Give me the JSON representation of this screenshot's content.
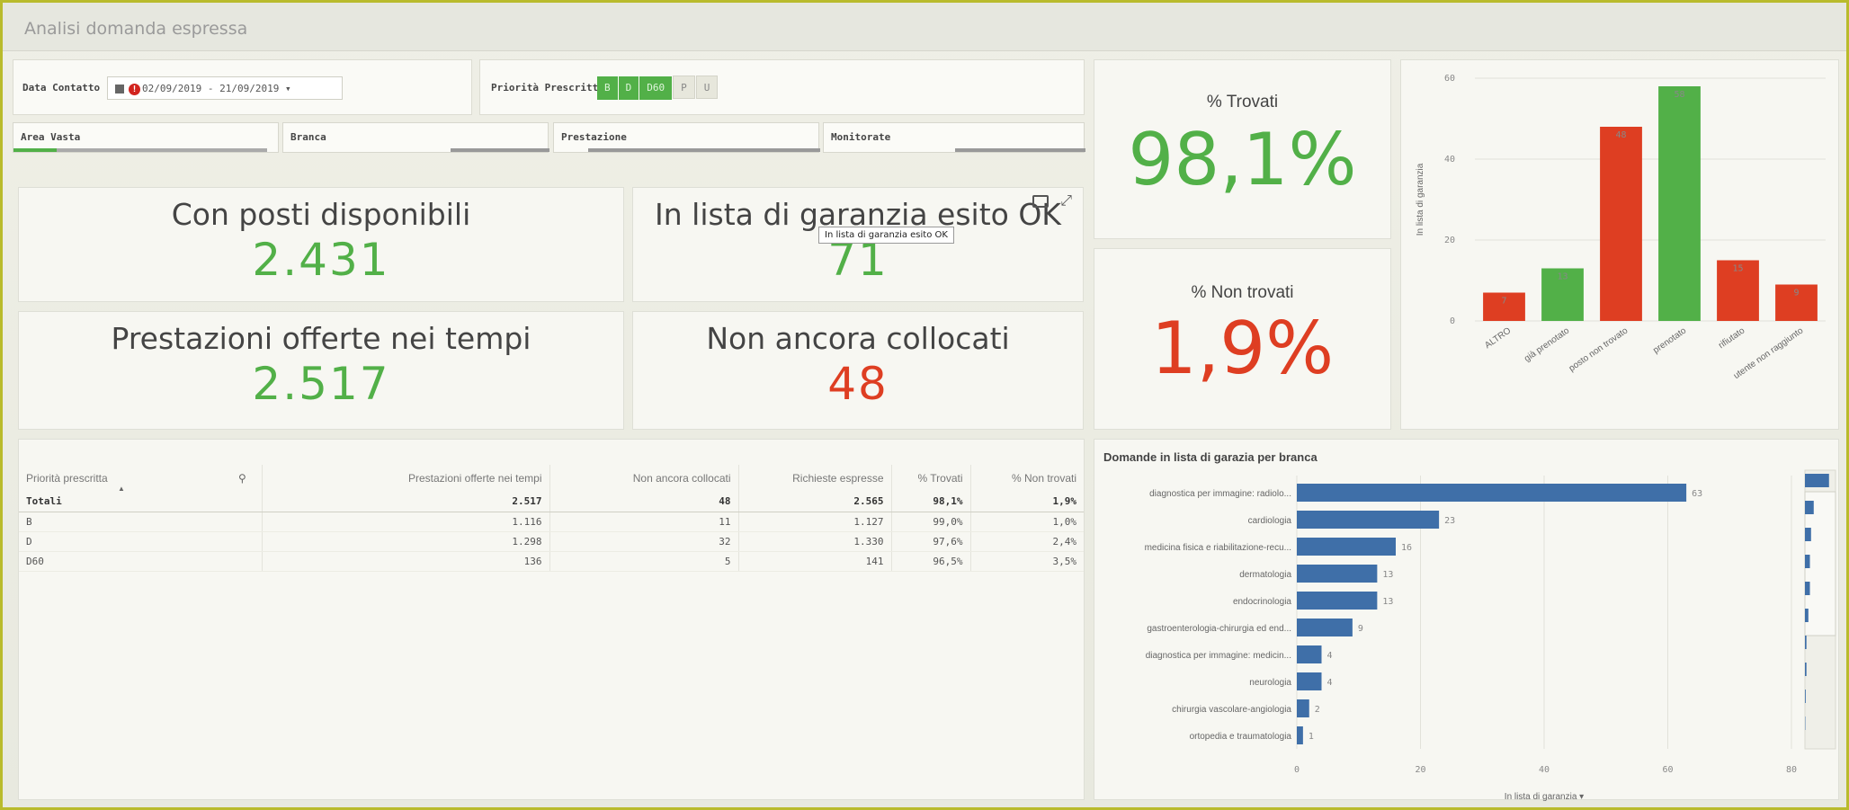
{
  "app_title": "Analisi domanda espressa",
  "filters": {
    "data_contatto_label": "Data Contatto",
    "data_contatto_value": "02/09/2019 - 21/09/2019 ▾",
    "priorita_label": "Priorità Prescritta",
    "priorita_chips": [
      {
        "label": "B",
        "selected": true
      },
      {
        "label": "D",
        "selected": true
      },
      {
        "label": "D60",
        "selected": true
      },
      {
        "label": "P",
        "selected": false
      },
      {
        "label": "U",
        "selected": false
      }
    ],
    "dimensions": [
      "Area Vasta",
      "Branca",
      "Prestazione",
      "Monitorate"
    ]
  },
  "kpis": {
    "con_posti": {
      "title": "Con posti disponibili",
      "value": "2.431"
    },
    "garanzia_ok": {
      "title": "In lista di garanzia esito OK",
      "value": "71",
      "tooltip": "In lista di garanzia esito OK"
    },
    "prestazioni_offerte": {
      "title": "Prestazioni offerte nei tempi",
      "value": "2.517"
    },
    "non_collocati": {
      "title": "Non ancora collocati",
      "value": "48"
    },
    "trovati": {
      "title": "% Trovati",
      "value": "98,1%"
    },
    "non_trovati": {
      "title": "% Non trovati",
      "value": "1,9%"
    }
  },
  "colors": {
    "green": "#52b048",
    "red": "#de3e22",
    "blue": "#3f6fa8"
  },
  "table": {
    "columns": [
      "Priorità prescritta",
      "Prestazioni offerte nei tempi",
      "Non ancora collocati",
      "Richieste espresse",
      "% Trovati",
      "% Non trovati"
    ],
    "total": [
      "Totali",
      "2.517",
      "48",
      "2.565",
      "98,1%",
      "1,9%"
    ],
    "rows": [
      [
        "B",
        "1.116",
        "11",
        "1.127",
        "99,0%",
        "1,0%"
      ],
      [
        "D",
        "1.298",
        "32",
        "1.330",
        "97,6%",
        "2,4%"
      ],
      [
        "D60",
        "136",
        "5",
        "141",
        "96,5%",
        "3,5%"
      ]
    ]
  },
  "chart_data": [
    {
      "type": "bar",
      "ylabel": "In lista di garanzia",
      "ylim": [
        0,
        60
      ],
      "yticks": [
        "0",
        "20",
        "40",
        "60"
      ],
      "categories": [
        "ALTRO",
        "già prenotato",
        "posto non trovato",
        "prenotato",
        "rifiutato",
        "utente non raggiunto"
      ],
      "values": [
        7,
        13,
        48,
        58,
        15,
        9
      ],
      "value_labels": [
        "7",
        "13",
        "48",
        "58",
        "15",
        "9"
      ],
      "bar_colors": [
        "#de3e22",
        "#52b048",
        "#de3e22",
        "#52b048",
        "#de3e22",
        "#de3e22"
      ]
    },
    {
      "type": "bar",
      "orientation": "horizontal",
      "title": "Domande in lista di garazia per branca",
      "xlabel": "In lista di garanzia ▾",
      "xlim": [
        0,
        80
      ],
      "xticks": [
        "0",
        "20",
        "40",
        "60",
        "80"
      ],
      "categories": [
        "diagnostica per immagine: radiolo...",
        "cardiologia",
        "medicina fisica e riabilitazione-recu...",
        "dermatologia",
        "endocrinologia",
        "gastroenterologia-chirurgia ed end...",
        "diagnostica per immagine: medicin...",
        "neurologia",
        "chirurgia vascolare-angiologia",
        "ortopedia e traumatologia"
      ],
      "values": [
        63,
        23,
        16,
        13,
        13,
        9,
        4,
        4,
        2,
        1
      ],
      "value_labels": [
        "63",
        "23",
        "16",
        "13",
        "13",
        "9",
        "4",
        "4",
        "2",
        "1"
      ]
    }
  ]
}
